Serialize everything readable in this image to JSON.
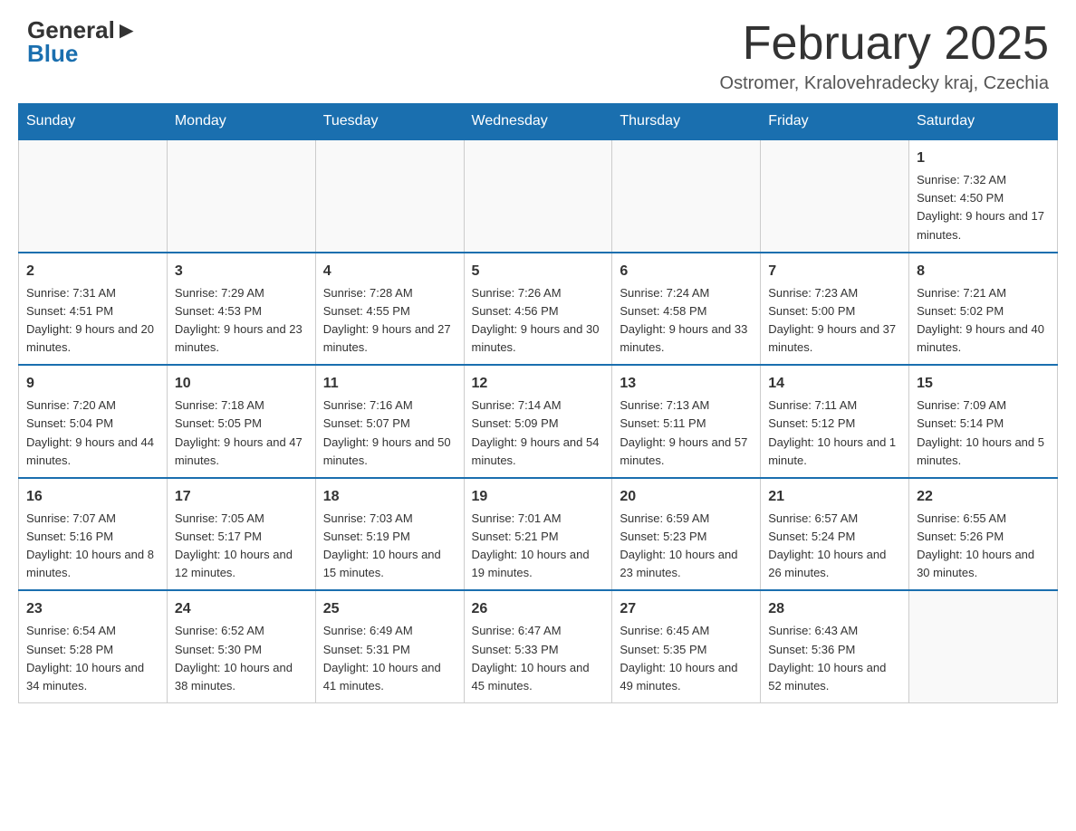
{
  "header": {
    "logo_general": "General",
    "logo_blue": "Blue",
    "month_title": "February 2025",
    "location": "Ostromer, Kralovehradecky kraj, Czechia"
  },
  "weekdays": [
    "Sunday",
    "Monday",
    "Tuesday",
    "Wednesday",
    "Thursday",
    "Friday",
    "Saturday"
  ],
  "weeks": [
    [
      {
        "day": "",
        "info": ""
      },
      {
        "day": "",
        "info": ""
      },
      {
        "day": "",
        "info": ""
      },
      {
        "day": "",
        "info": ""
      },
      {
        "day": "",
        "info": ""
      },
      {
        "day": "",
        "info": ""
      },
      {
        "day": "1",
        "info": "Sunrise: 7:32 AM\nSunset: 4:50 PM\nDaylight: 9 hours and 17 minutes."
      }
    ],
    [
      {
        "day": "2",
        "info": "Sunrise: 7:31 AM\nSunset: 4:51 PM\nDaylight: 9 hours and 20 minutes."
      },
      {
        "day": "3",
        "info": "Sunrise: 7:29 AM\nSunset: 4:53 PM\nDaylight: 9 hours and 23 minutes."
      },
      {
        "day": "4",
        "info": "Sunrise: 7:28 AM\nSunset: 4:55 PM\nDaylight: 9 hours and 27 minutes."
      },
      {
        "day": "5",
        "info": "Sunrise: 7:26 AM\nSunset: 4:56 PM\nDaylight: 9 hours and 30 minutes."
      },
      {
        "day": "6",
        "info": "Sunrise: 7:24 AM\nSunset: 4:58 PM\nDaylight: 9 hours and 33 minutes."
      },
      {
        "day": "7",
        "info": "Sunrise: 7:23 AM\nSunset: 5:00 PM\nDaylight: 9 hours and 37 minutes."
      },
      {
        "day": "8",
        "info": "Sunrise: 7:21 AM\nSunset: 5:02 PM\nDaylight: 9 hours and 40 minutes."
      }
    ],
    [
      {
        "day": "9",
        "info": "Sunrise: 7:20 AM\nSunset: 5:04 PM\nDaylight: 9 hours and 44 minutes."
      },
      {
        "day": "10",
        "info": "Sunrise: 7:18 AM\nSunset: 5:05 PM\nDaylight: 9 hours and 47 minutes."
      },
      {
        "day": "11",
        "info": "Sunrise: 7:16 AM\nSunset: 5:07 PM\nDaylight: 9 hours and 50 minutes."
      },
      {
        "day": "12",
        "info": "Sunrise: 7:14 AM\nSunset: 5:09 PM\nDaylight: 9 hours and 54 minutes."
      },
      {
        "day": "13",
        "info": "Sunrise: 7:13 AM\nSunset: 5:11 PM\nDaylight: 9 hours and 57 minutes."
      },
      {
        "day": "14",
        "info": "Sunrise: 7:11 AM\nSunset: 5:12 PM\nDaylight: 10 hours and 1 minute."
      },
      {
        "day": "15",
        "info": "Sunrise: 7:09 AM\nSunset: 5:14 PM\nDaylight: 10 hours and 5 minutes."
      }
    ],
    [
      {
        "day": "16",
        "info": "Sunrise: 7:07 AM\nSunset: 5:16 PM\nDaylight: 10 hours and 8 minutes."
      },
      {
        "day": "17",
        "info": "Sunrise: 7:05 AM\nSunset: 5:17 PM\nDaylight: 10 hours and 12 minutes."
      },
      {
        "day": "18",
        "info": "Sunrise: 7:03 AM\nSunset: 5:19 PM\nDaylight: 10 hours and 15 minutes."
      },
      {
        "day": "19",
        "info": "Sunrise: 7:01 AM\nSunset: 5:21 PM\nDaylight: 10 hours and 19 minutes."
      },
      {
        "day": "20",
        "info": "Sunrise: 6:59 AM\nSunset: 5:23 PM\nDaylight: 10 hours and 23 minutes."
      },
      {
        "day": "21",
        "info": "Sunrise: 6:57 AM\nSunset: 5:24 PM\nDaylight: 10 hours and 26 minutes."
      },
      {
        "day": "22",
        "info": "Sunrise: 6:55 AM\nSunset: 5:26 PM\nDaylight: 10 hours and 30 minutes."
      }
    ],
    [
      {
        "day": "23",
        "info": "Sunrise: 6:54 AM\nSunset: 5:28 PM\nDaylight: 10 hours and 34 minutes."
      },
      {
        "day": "24",
        "info": "Sunrise: 6:52 AM\nSunset: 5:30 PM\nDaylight: 10 hours and 38 minutes."
      },
      {
        "day": "25",
        "info": "Sunrise: 6:49 AM\nSunset: 5:31 PM\nDaylight: 10 hours and 41 minutes."
      },
      {
        "day": "26",
        "info": "Sunrise: 6:47 AM\nSunset: 5:33 PM\nDaylight: 10 hours and 45 minutes."
      },
      {
        "day": "27",
        "info": "Sunrise: 6:45 AM\nSunset: 5:35 PM\nDaylight: 10 hours and 49 minutes."
      },
      {
        "day": "28",
        "info": "Sunrise: 6:43 AM\nSunset: 5:36 PM\nDaylight: 10 hours and 52 minutes."
      },
      {
        "day": "",
        "info": ""
      }
    ]
  ]
}
